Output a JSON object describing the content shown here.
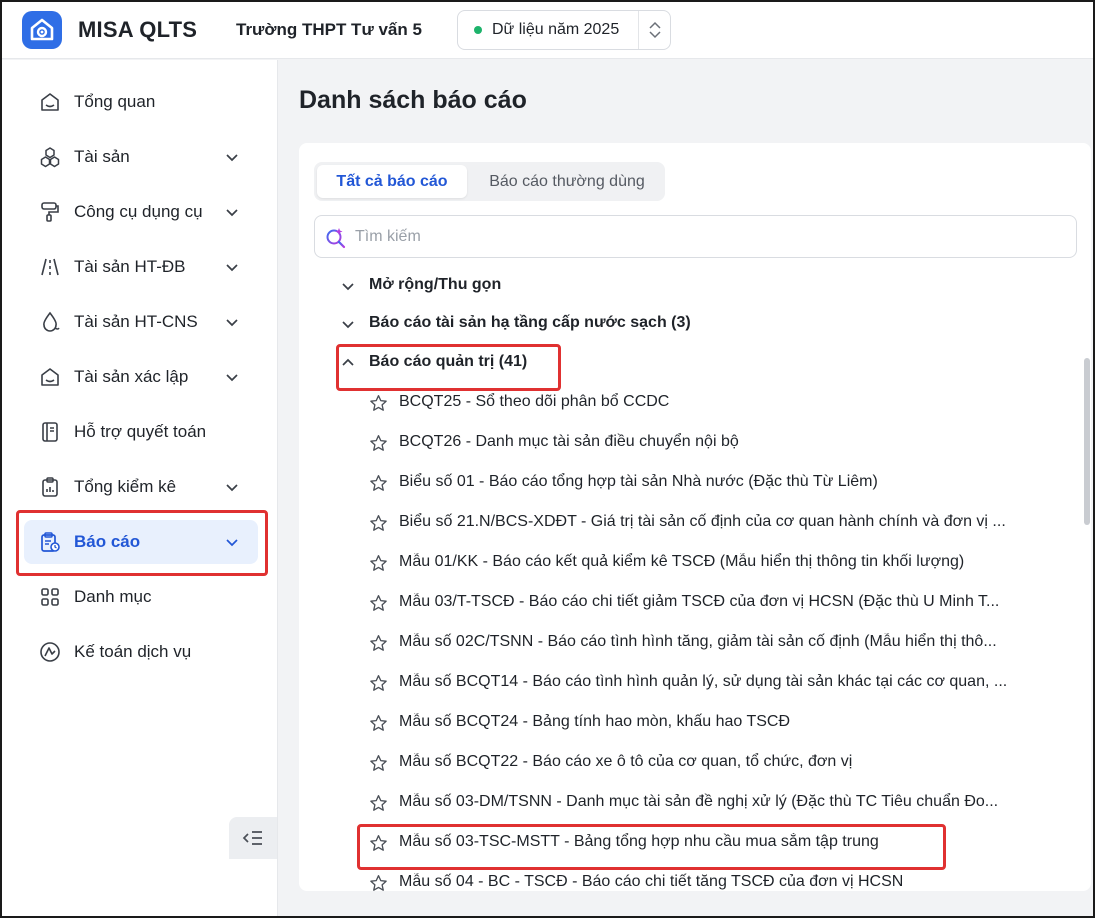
{
  "header": {
    "app_name": "MISA QLTS",
    "school": "Trường THPT Tư vấn 5",
    "year_label": "Dữ liệu năm 2025",
    "status_color": "#1db36b"
  },
  "sidebar": {
    "items": [
      {
        "label": "Tổng quan",
        "icon": "home-icon",
        "chevron": false
      },
      {
        "label": "Tài sản",
        "icon": "cubes-icon",
        "chevron": true
      },
      {
        "label": "Công cụ dụng cụ",
        "icon": "paint-roller-icon",
        "chevron": true
      },
      {
        "label": "Tài sản HT-ĐB",
        "icon": "road-icon",
        "chevron": true
      },
      {
        "label": "Tài sản HT-CNS",
        "icon": "water-drop-icon",
        "chevron": true
      },
      {
        "label": "Tài sản xác lập",
        "icon": "home-icon",
        "chevron": true
      },
      {
        "label": "Hỗ trợ quyết toán",
        "icon": "book-icon",
        "chevron": false
      },
      {
        "label": "Tổng kiểm kê",
        "icon": "clipboard-chart-icon",
        "chevron": true
      },
      {
        "label": "Báo cáo",
        "icon": "report-clipboard-icon",
        "chevron": true,
        "active": true
      },
      {
        "label": "Danh mục",
        "icon": "grid-icon",
        "chevron": false
      },
      {
        "label": "Kế toán dịch vụ",
        "icon": "accounting-logo-icon",
        "chevron": false
      }
    ],
    "accent_color": "#2257d6"
  },
  "main": {
    "title": "Danh sách báo cáo",
    "tabs": [
      {
        "label": "Tất cả báo cáo",
        "active": true
      },
      {
        "label": "Báo cáo thường dùng",
        "active": false
      }
    ],
    "search_placeholder": "Tìm kiếm",
    "expand_collapse_label": "Mở rộng/Thu gọn",
    "groups": [
      {
        "label": "Báo cáo tài sản hạ tầng cấp nước sạch (3)",
        "expanded": false
      },
      {
        "label": "Báo cáo quản trị (41)",
        "expanded": true
      }
    ],
    "reports": [
      "BCQT25 - Sổ theo dõi phân bổ CCDC",
      "BCQT26 - Danh mục tài sản điều chuyển nội bộ",
      "Biểu số 01 - Báo cáo tổng hợp tài sản Nhà nước (Đặc thù Từ Liêm)",
      "Biểu số 21.N/BCS-XDĐT - Giá trị tài sản cố định của cơ quan hành chính và đơn vị ...",
      "Mẫu 01/KK - Báo cáo kết quả kiểm kê TSCĐ (Mẫu hiển thị thông tin khối lượng)",
      "Mẫu 03/T-TSCĐ - Báo cáo chi tiết giảm TSCĐ của đơn vị HCSN (Đặc thù U Minh T...",
      "Mẫu số 02C/TSNN - Báo cáo tình hình tăng, giảm tài sản cố định (Mẫu hiển thị thô...",
      "Mẫu số BCQT14 - Báo cáo tình hình quản lý, sử dụng tài sản khác tại các cơ quan, ...",
      "Mẫu số BCQT24 - Bảng tính hao mòn, khấu hao TSCĐ",
      "Mẫu số BCQT22 - Báo cáo xe ô tô của cơ quan, tổ chức, đơn vị",
      "Mẫu số 03-DM/TSNN - Danh mục tài sản đề nghị xử lý (Đặc thù TC Tiêu chuẩn Đo...",
      "Mẫu số 03-TSC-MSTT - Bảng tổng hợp nhu cầu mua sắm tập trung",
      "Mẫu số 04 - BC - TSCĐ - Báo cáo chi tiết tăng TSCĐ của đơn vị HCSN"
    ]
  }
}
